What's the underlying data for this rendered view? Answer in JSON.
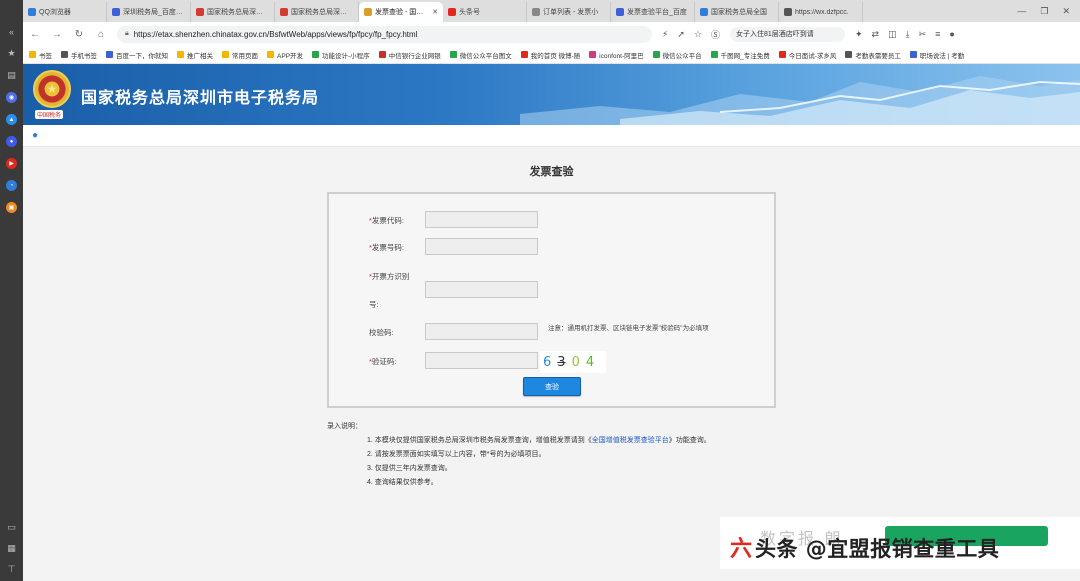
{
  "tabs": [
    {
      "label": "QQ浏览器",
      "color": "#2f7ed8",
      "active": false
    },
    {
      "label": "深圳税务局_百度搜索",
      "color": "#3a62d6",
      "active": false
    },
    {
      "label": "国家税务总局深圳市",
      "color": "#d33b2f",
      "active": false
    },
    {
      "label": "国家税务总局深圳市",
      "color": "#d33b2f",
      "active": false
    },
    {
      "label": "发票查验 - 国家税",
      "color": "#d8a02b",
      "active": true
    },
    {
      "label": "头条号",
      "color": "#e0281e",
      "active": false
    },
    {
      "label": "订单列表 - 发票小",
      "color": "#888888",
      "active": false
    },
    {
      "label": "发票查验平台_百度",
      "color": "#3a62d6",
      "active": false
    },
    {
      "label": "国家税务总局全国",
      "color": "#2f7ed8",
      "active": false
    },
    {
      "label": "https://wx.dzfpcc.",
      "color": "#555555",
      "active": false
    }
  ],
  "address": {
    "url": "https://etax.shenzhen.chinatax.gov.cn/BsfwtWeb/apps/views/fp/fpcy/fp_fpcy.html",
    "news": "女子入住81层酒店吓到请"
  },
  "bookmarks": [
    {
      "label": "书签",
      "color": "#f2b705"
    },
    {
      "label": "手机书签",
      "color": "#555555"
    },
    {
      "label": "百度一下，你就知",
      "color": "#3a62d6"
    },
    {
      "label": "推广相关",
      "color": "#f2b705"
    },
    {
      "label": "常用页面",
      "color": "#f2b705"
    },
    {
      "label": "APP开发",
      "color": "#f2b705"
    },
    {
      "label": "功能设计-小程序",
      "color": "#2aa44a"
    },
    {
      "label": "中信银行企业网银",
      "color": "#c2312a"
    },
    {
      "label": "微信公众平台图文",
      "color": "#2aa44a"
    },
    {
      "label": "我的首页 微博-随",
      "color": "#e0281e"
    },
    {
      "label": "iconfont-阿里巴",
      "color": "#d33b7f"
    },
    {
      "label": "微信公众平台",
      "color": "#2aa44a"
    },
    {
      "label": "千图网_专注免费",
      "color": "#2aa44a"
    },
    {
      "label": "今日面试-求乡风",
      "color": "#e0281e"
    },
    {
      "label": "考勤表需要员工",
      "color": "#555555"
    },
    {
      "label": "职场说法 | 考勤",
      "color": "#3a62d6"
    }
  ],
  "banner": {
    "title": "国家税务总局深圳市电子税务局",
    "emblem_caption": "中国税务"
  },
  "form": {
    "title": "发票查验",
    "fields": {
      "code": {
        "label": "发票代码:",
        "required": true
      },
      "number": {
        "label": "发票号码:",
        "required": true
      },
      "id_line1": {
        "label": "开票方识别",
        "required": true
      },
      "id_line2": {
        "label": "号:"
      },
      "check": {
        "label": "校验码:",
        "required": false
      },
      "captcha": {
        "label": "验证码:",
        "required": true
      }
    },
    "required_mark": "*",
    "note": "注意：通用机打发票、区块链电子发票\"校验码\"为必填项",
    "captcha_digits": [
      {
        "ch": "6",
        "color": "#2b8cd6"
      },
      {
        "ch": "3",
        "color": "#333333"
      },
      {
        "ch": "0",
        "color": "#8cc63f"
      },
      {
        "ch": "4",
        "color": "#55c01b"
      }
    ],
    "submit_label": "查验"
  },
  "instructions": {
    "heading": "录入说明：",
    "item1_before": "1. 本模块仅提供国家税务总局深圳市税务局发票查询，增值税发票请到《",
    "item1_link": "全国增值税发票查验平台",
    "item1_after": "》功能查询。",
    "item2": "2. 请按发票票面如实填写以上内容，带*号的为必填项目。",
    "item3": "3. 仅提供三年内发票查询。",
    "item4": "4. 查询结果仅供参考。"
  },
  "watermark": {
    "logo": "六",
    "text": "头条 @宜盟报销查重工具",
    "faint": "数字报  朗"
  }
}
